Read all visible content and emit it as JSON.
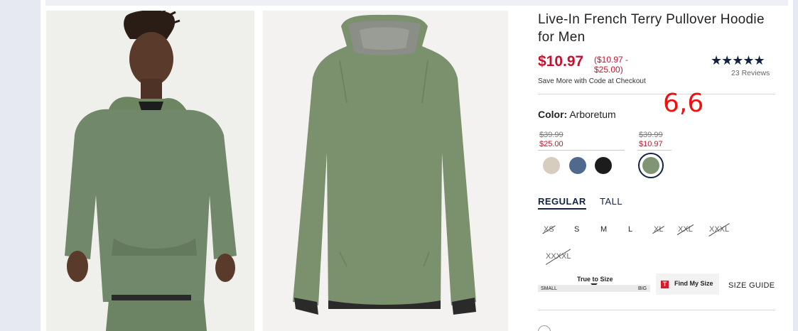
{
  "product": {
    "title": "Live-In French Terry Pullover Hoodie for Men",
    "price": "$10.97",
    "price_range": "($10.97 -\n$25.00)",
    "promo": "Save More with Code at Checkout",
    "stars": "★★★★★",
    "reviews": "23 Reviews"
  },
  "annotation": "6,6",
  "color": {
    "label": "Color:",
    "value": "Arboretum",
    "groups": [
      {
        "was": "$39.99",
        "now": "$25.00"
      },
      {
        "was": "$39.99",
        "now": "$10.97"
      }
    ],
    "swatches": [
      "#d6cdbf",
      "#4f6a8c",
      "#1c1c1c",
      "#7f9573"
    ]
  },
  "fit_tabs": {
    "regular": "REGULAR",
    "tall": "TALL"
  },
  "sizes": [
    {
      "label": "XS",
      "available": false
    },
    {
      "label": "S",
      "available": true
    },
    {
      "label": "M",
      "available": true
    },
    {
      "label": "L",
      "available": true
    },
    {
      "label": "XL",
      "available": false
    },
    {
      "label": "XXL",
      "available": false
    },
    {
      "label": "XXXL",
      "available": false
    },
    {
      "label": "XXXXL",
      "available": false
    }
  ],
  "true_to_size": {
    "title": "True to Size",
    "small": "SMALL",
    "big": "BIG"
  },
  "find_my_size": {
    "icon": "T",
    "label": "Find My Size"
  },
  "size_guide": "SIZE GUIDE",
  "colors": {
    "accent": "#122344",
    "sale": "#c8102e",
    "annotation": "#f01010"
  }
}
